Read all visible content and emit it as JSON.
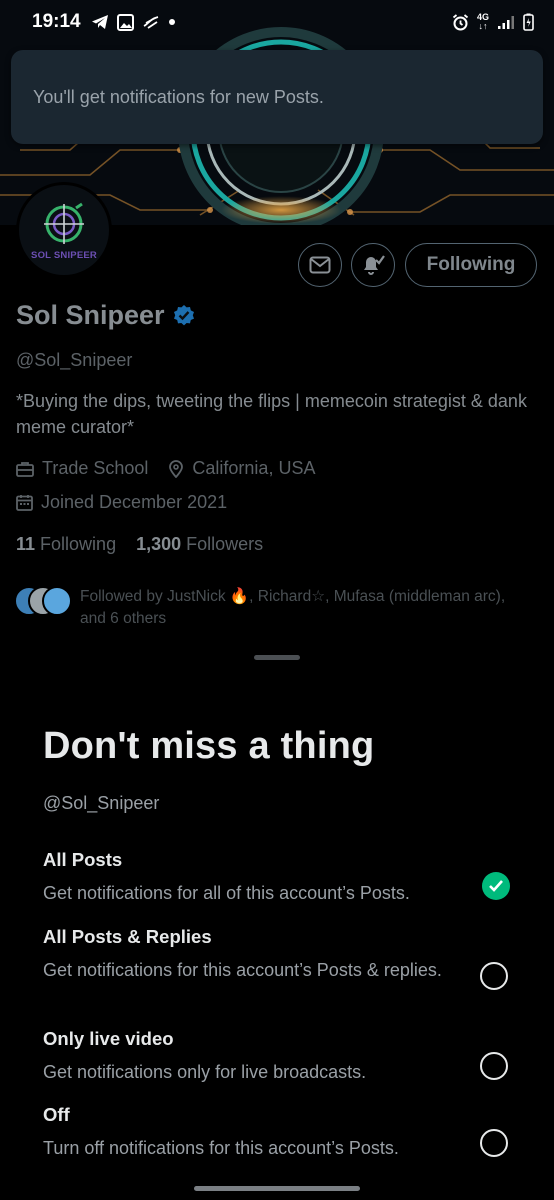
{
  "status_bar": {
    "time": "19:14",
    "network": "4G"
  },
  "toast": {
    "message": "You'll get notifications for new Posts."
  },
  "profile": {
    "avatar_text": "SOL SNIPEER",
    "display_name": "Sol Snipeer",
    "handle": "@Sol_Snipeer",
    "bio": "*Buying the dips, tweeting the flips | memecoin strategist & dank meme curator*",
    "category": "Trade School",
    "location": "California, USA",
    "joined": "Joined December 2021",
    "following_count": "11",
    "following_label": "Following",
    "followers_count": "1,300",
    "followers_label": "Followers",
    "followed_by": "Followed by JustNick 🔥, Richard☆, Mufasa (middleman arc), and 6 others",
    "following_button": "Following",
    "verified_color": "#1d9bf0"
  },
  "sheet": {
    "title": "Don't miss a thing",
    "handle": "@Sol_Snipeer",
    "options": [
      {
        "title": "All Posts",
        "description": "Get notifications for all of this account’s Posts.",
        "selected": true
      },
      {
        "title": "All Posts & Replies",
        "description": "Get notifications for this account’s Posts & replies.",
        "selected": false
      },
      {
        "title": "Only live video",
        "description": "Get notifications only for live broadcasts.",
        "selected": false
      },
      {
        "title": "Off",
        "description": "Turn off notifications for this account’s Posts.",
        "selected": false
      }
    ],
    "selected_color": "#00ba7c"
  }
}
